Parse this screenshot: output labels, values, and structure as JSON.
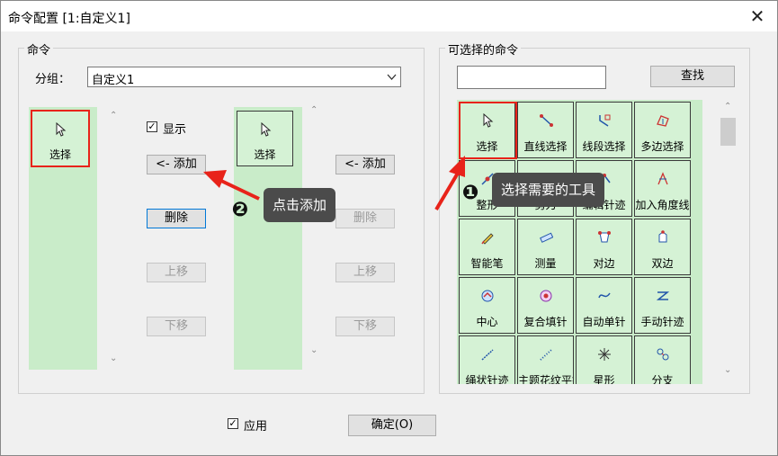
{
  "window": {
    "title": "命令配置 [1:自定义1]",
    "close_glyph": "✕"
  },
  "command_group": {
    "label": "命令",
    "group_label": "分组：",
    "group_value": "自定义1",
    "current_item": "选择",
    "show_label": "显示",
    "show_checked": true,
    "add_label": "<- 添加",
    "delete_label": "删除",
    "up_label": "上移",
    "down_label": "下移",
    "second_item": "选择",
    "right_add_label": "<- 添加",
    "right_delete_label": "删除",
    "right_up_label": "上移",
    "right_down_label": "下移"
  },
  "selectable": {
    "label": "可选择的命令",
    "search_value": "",
    "search_button": "查找",
    "commands": [
      {
        "label": "选择",
        "icon": "cursor-icon"
      },
      {
        "label": "直线选择",
        "icon": "line-select-icon"
      },
      {
        "label": "线段选择",
        "icon": "segment-select-icon"
      },
      {
        "label": "多边选择",
        "icon": "polygon-select-icon"
      },
      {
        "label": "整形",
        "icon": "reshape-icon"
      },
      {
        "label": "剪刀",
        "icon": "scissors-icon"
      },
      {
        "label": "编辑针迹",
        "icon": "edit-stitch-icon"
      },
      {
        "label": "加入角度线",
        "icon": "angle-line-icon"
      },
      {
        "label": "智能笔",
        "icon": "smart-pen-icon"
      },
      {
        "label": "测量",
        "icon": "measure-icon"
      },
      {
        "label": "对边",
        "icon": "opposite-edge-icon"
      },
      {
        "label": "双边",
        "icon": "double-edge-icon"
      },
      {
        "label": "中心",
        "icon": "center-icon"
      },
      {
        "label": "复合填针",
        "icon": "composite-fill-icon"
      },
      {
        "label": "自动单针",
        "icon": "auto-single-stitch-icon"
      },
      {
        "label": "手动针迹",
        "icon": "manual-stitch-icon"
      },
      {
        "label": "绳状针迹",
        "icon": "rope-stitch-icon"
      },
      {
        "label": "主题花纹平针",
        "icon": "motif-running-icon"
      },
      {
        "label": "星形",
        "icon": "star-icon"
      },
      {
        "label": "分支",
        "icon": "branch-icon"
      }
    ]
  },
  "annotations": {
    "step1_number": "❶",
    "step1_text": "选择需要的工具",
    "step2_number": "❷",
    "step2_text": "点击添加"
  },
  "footer": {
    "apply_label": "应用",
    "apply_checked": true,
    "ok_label": "确定(O)"
  },
  "colors": {
    "highlight": "#e8231a",
    "cell_bg": "#d5f2d5",
    "strip_bg": "#c9ecc9"
  }
}
